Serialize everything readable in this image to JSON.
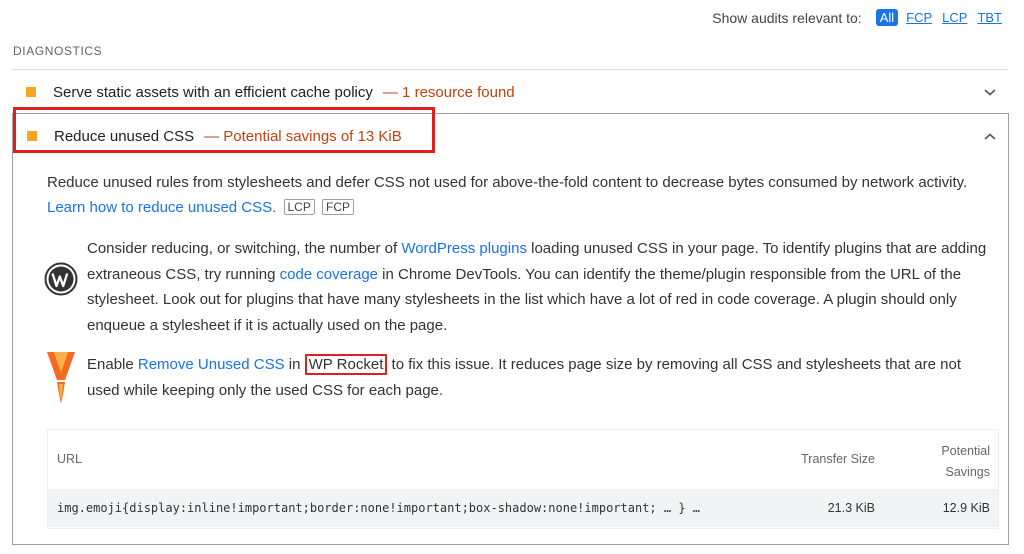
{
  "filter": {
    "label": "Show audits relevant to:",
    "chips": [
      "All",
      "FCP",
      "LCP",
      "TBT"
    ]
  },
  "section": {
    "title": "DIAGNOSTICS"
  },
  "audits": [
    {
      "title": "Serve static assets with an efficient cache policy",
      "display": "— 1 resource found",
      "status_color": "#f6a623"
    },
    {
      "title": "Reduce unused CSS",
      "display": "— Potential savings of 13 KiB",
      "status_color": "#f6a623",
      "description": {
        "text": "Reduce unused rules from stylesheets and defer CSS not used for above-the-fold content to decrease bytes consumed by network activity.",
        "link": "Learn how to reduce unused CSS.",
        "tags": [
          "LCP",
          "FCP"
        ]
      },
      "stack_packs": [
        {
          "icon": "wordpress-icon",
          "parts": {
            "a": "Consider reducing, or switching, the number of ",
            "link1": "WordPress plugins",
            "b": " loading unused CSS in your page. To identify plugins that are adding extraneous CSS, try running ",
            "link2": "code coverage",
            "c": " in Chrome DevTools. You can identify the theme/plugin responsible from the URL of the stylesheet. Look out for plugins that have many stylesheets in the list which have a lot of red in code coverage. A plugin should only enqueue a stylesheet if it is actually used on the page."
          }
        },
        {
          "icon": "wp-rocket-icon",
          "parts": {
            "a": "Enable ",
            "link1": "Remove Unused CSS",
            "b": " in ",
            "boxed": "WP Rocket",
            "c": " to fix this issue. It reduces page size by removing all CSS and stylesheets that are not used while keeping only the used CSS for each page."
          }
        }
      ],
      "table": {
        "headers": {
          "url": "URL",
          "transfer": "Transfer Size",
          "potential_1": "Potential",
          "potential_2": "Savings"
        },
        "rows": [
          {
            "url": "img.emoji{display:inline!important;border:none!important;box-shadow:none!important; … } …",
            "transfer": "21.3 KiB",
            "savings": "12.9 KiB"
          }
        ]
      }
    }
  ],
  "icons": {
    "chevron_down": "chevron-down-icon",
    "chevron_up": "chevron-up-icon"
  }
}
